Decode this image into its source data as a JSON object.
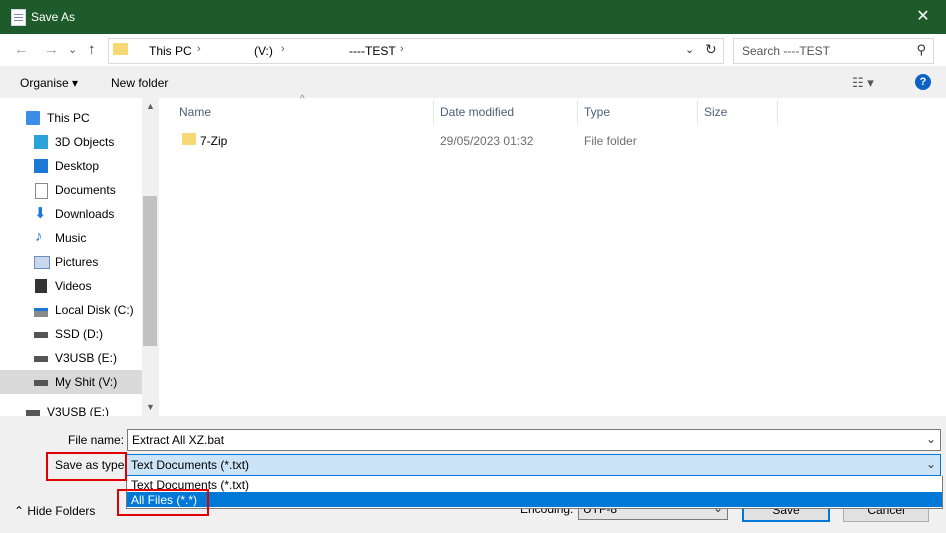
{
  "window": {
    "title": "Save As",
    "close_glyph": "✕"
  },
  "nav": {
    "back_glyph": "←",
    "forward_glyph": "→",
    "recent_glyph": "⌄",
    "up_glyph": "↑",
    "breadcrumbs": [
      "This PC",
      "(V:)",
      "----TEST"
    ],
    "crumb_sep": "›",
    "dropdown_glyph": "⌄",
    "refresh_glyph": "↻",
    "search_placeholder": "Search ----TEST",
    "search_glyph": "⚲"
  },
  "toolbar": {
    "organise": "Organise ▾",
    "new_folder": "New folder",
    "view_glyph": "☷ ▾",
    "help": "?"
  },
  "sidebar": {
    "items": [
      {
        "label": "This PC",
        "icon": "computer-icon",
        "color": "#3a8ee6"
      },
      {
        "label": "3D Objects",
        "icon": "cube-icon",
        "color": "#29a3d8"
      },
      {
        "label": "Desktop",
        "icon": "desktop-icon",
        "color": "#1b78d6"
      },
      {
        "label": "Documents",
        "icon": "document-icon",
        "color": "#8a8a8a"
      },
      {
        "label": "Downloads",
        "icon": "download-icon",
        "color": "#1b78d6"
      },
      {
        "label": "Music",
        "icon": "music-icon",
        "color": "#1b78d6"
      },
      {
        "label": "Pictures",
        "icon": "pictures-icon",
        "color": "#6b8fbf"
      },
      {
        "label": "Videos",
        "icon": "videos-icon",
        "color": "#333333"
      },
      {
        "label": "Local Disk (C:)",
        "icon": "drive-icon",
        "color": "#555555"
      },
      {
        "label": "SSD (D:)",
        "icon": "drive-icon",
        "color": "#555555"
      },
      {
        "label": "V3USB (E:)",
        "icon": "drive-icon",
        "color": "#555555"
      },
      {
        "label": "My Shit (V:)",
        "icon": "drive-icon",
        "color": "#555555"
      },
      {
        "label": "V3USB (E:)",
        "icon": "drive-icon",
        "color": "#555555"
      }
    ],
    "scroll_up": "▲",
    "scroll_down": "▼"
  },
  "files": {
    "columns": [
      "Name",
      "Date modified",
      "Type",
      "Size"
    ],
    "sort_glyph": "^",
    "rows": [
      {
        "name": "7-Zip",
        "date": "29/05/2023 01:32",
        "type": "File folder",
        "size": ""
      }
    ]
  },
  "form": {
    "file_name_label": "File name:",
    "file_name_value": "Extract All XZ.bat",
    "save_as_type_label": "Save as type:",
    "save_as_type_value": "Text Documents (*.txt)",
    "type_options": [
      "Text Documents (*.txt)",
      "All Files  (*.*)"
    ],
    "combo_arrow": "⌄",
    "encoding_label": "Encoding:",
    "encoding_value": "UTF-8",
    "hide_folders": "⌃  Hide Folders",
    "save": "Save",
    "cancel": "Cancel"
  },
  "colors": {
    "title_bar": "#1e5b2a",
    "accent": "#0078d7",
    "highlight_box": "#e00000",
    "folder": "#f8d775"
  }
}
